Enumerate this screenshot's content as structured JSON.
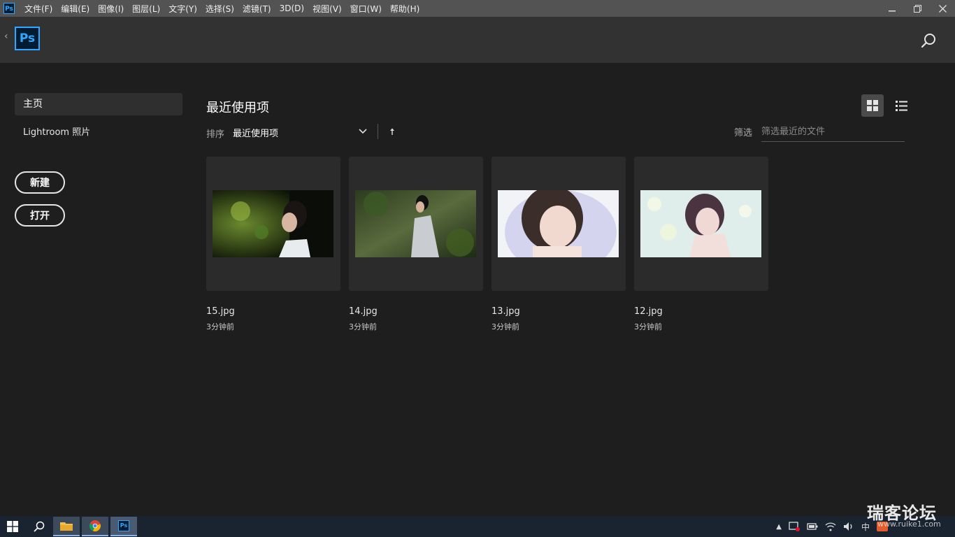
{
  "menubar": {
    "app_icon": "Ps",
    "items": [
      "文件(F)",
      "编辑(E)",
      "图像(I)",
      "图层(L)",
      "文字(Y)",
      "选择(S)",
      "滤镜(T)",
      "3D(D)",
      "视图(V)",
      "窗口(W)",
      "帮助(H)"
    ]
  },
  "header": {
    "logo": "Ps"
  },
  "sidebar": {
    "items": [
      {
        "label": "主页"
      },
      {
        "label": "Lightroom 照片"
      }
    ],
    "new_label": "新建",
    "open_label": "打开"
  },
  "main": {
    "title": "最近使用项",
    "sort_label": "排序",
    "sort_value": "最近使用项",
    "filter_label": "筛选",
    "filter_placeholder": "筛选最近的文件",
    "files": [
      {
        "name": "15.jpg",
        "time": "3分钟前"
      },
      {
        "name": "14.jpg",
        "time": "3分钟前"
      },
      {
        "name": "13.jpg",
        "time": "3分钟前"
      },
      {
        "name": "12.jpg",
        "time": "3分钟前"
      }
    ]
  },
  "taskbar": {
    "ps_label": "Ps",
    "tray_ime": "中",
    "watermark": "瑞客论坛",
    "watermark_url": "www.ruike1.com"
  },
  "colors": {
    "accent": "#31a8ff",
    "bg": "#1e1e1e",
    "header": "#323232",
    "card": "#2b2b2b"
  }
}
